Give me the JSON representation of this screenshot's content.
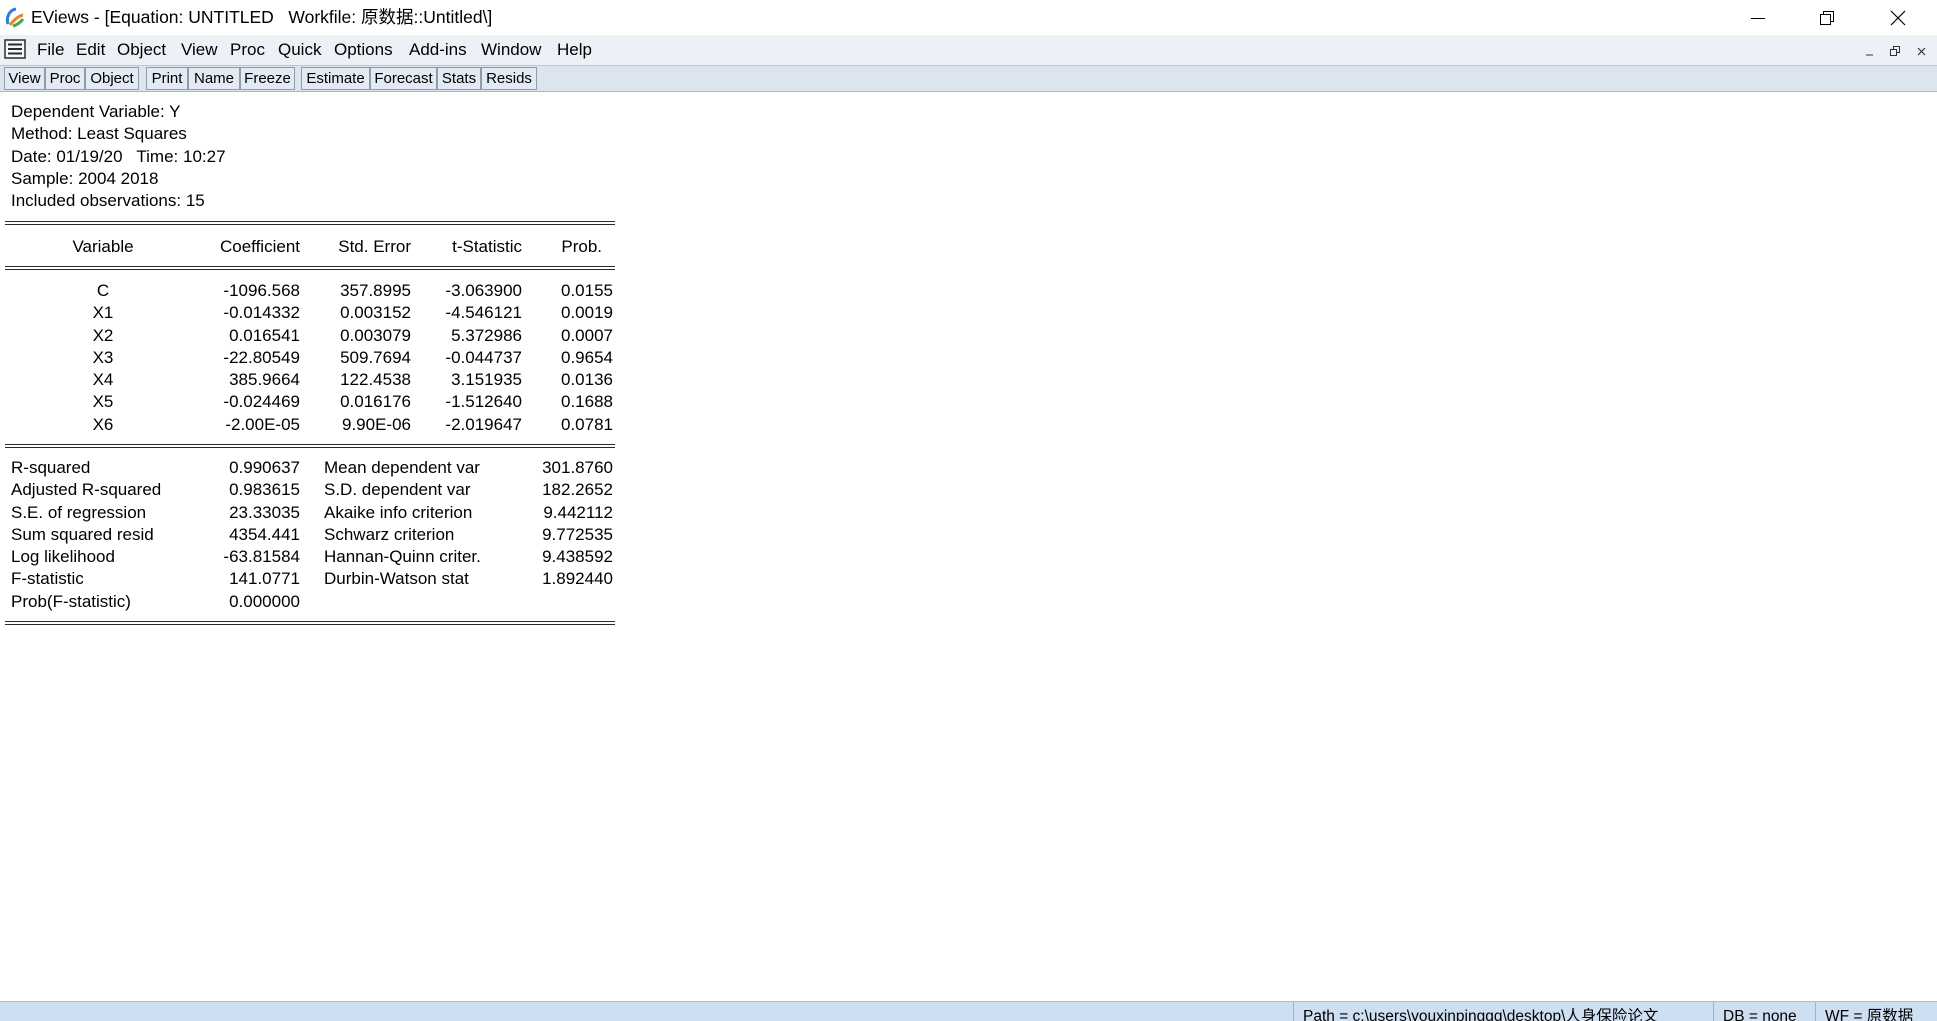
{
  "window": {
    "title": "EViews - [Equation: UNTITLED   Workfile: 原数据::Untitled\\]",
    "app_icon": "eviews-app-icon",
    "controls": [
      "minimize-icon",
      "restore-icon",
      "close-icon"
    ]
  },
  "menu": {
    "doc_icon": "document-menu-icon",
    "items": [
      "File",
      "Edit",
      "Object",
      "View",
      "Proc",
      "Quick",
      "Options",
      "Add-ins",
      "Window",
      "Help"
    ],
    "child_controls": [
      "minimize-icon",
      "restore-icon",
      "close-icon"
    ]
  },
  "toolbar": {
    "buttons": [
      "View",
      "Proc",
      "Object",
      "Print",
      "Name",
      "Freeze",
      "Estimate",
      "Forecast",
      "Stats",
      "Resids"
    ]
  },
  "output": {
    "header_lines": [
      "Dependent Variable: Y",
      "Method: Least Squares",
      "Date: 01/19/20   Time: 10:27",
      "Sample: 2004 2018",
      "Included observations: 15"
    ],
    "columns": [
      "Variable",
      "Coefficient",
      "Std. Error",
      "t-Statistic",
      "Prob."
    ],
    "coefficients": [
      [
        "C",
        "-1096.568",
        "357.8995",
        "-3.063900",
        "0.0155"
      ],
      [
        "X1",
        "-0.014332",
        "0.003152",
        "-4.546121",
        "0.0019"
      ],
      [
        "X2",
        "0.016541",
        "0.003079",
        "5.372986",
        "0.0007"
      ],
      [
        "X3",
        "-22.80549",
        "509.7694",
        "-0.044737",
        "0.9654"
      ],
      [
        "X4",
        "385.9664",
        "122.4538",
        "3.151935",
        "0.0136"
      ],
      [
        "X5",
        "-0.024469",
        "0.016176",
        "-1.512640",
        "0.1688"
      ],
      [
        "X6",
        "-2.00E-05",
        "9.90E-06",
        "-2.019647",
        "0.0781"
      ]
    ],
    "statistics": [
      [
        "R-squared",
        "0.990637",
        "Mean dependent var",
        "301.8760"
      ],
      [
        "Adjusted R-squared",
        "0.983615",
        "S.D. dependent var",
        "182.2652"
      ],
      [
        "S.E. of regression",
        "23.33035",
        "Akaike info criterion",
        "9.442112"
      ],
      [
        "Sum squared resid",
        "4354.441",
        "Schwarz criterion",
        "9.772535"
      ],
      [
        "Log likelihood",
        "-63.81584",
        "Hannan-Quinn criter.",
        "9.438592"
      ],
      [
        "F-statistic",
        "141.0771",
        "Durbin-Watson stat",
        "1.892440"
      ],
      [
        "Prob(F-statistic)",
        "0.000000"
      ]
    ]
  },
  "statusbar": {
    "path": "Path = c:\\users\\youxinpingqq\\desktop\\人身保险论文",
    "db": "DB = none",
    "wf": "WF = 原数据"
  },
  "colors": {
    "menubar": "#edf1f7",
    "toolbar": "#dce4ee",
    "statusbar": "#cfdff2"
  }
}
